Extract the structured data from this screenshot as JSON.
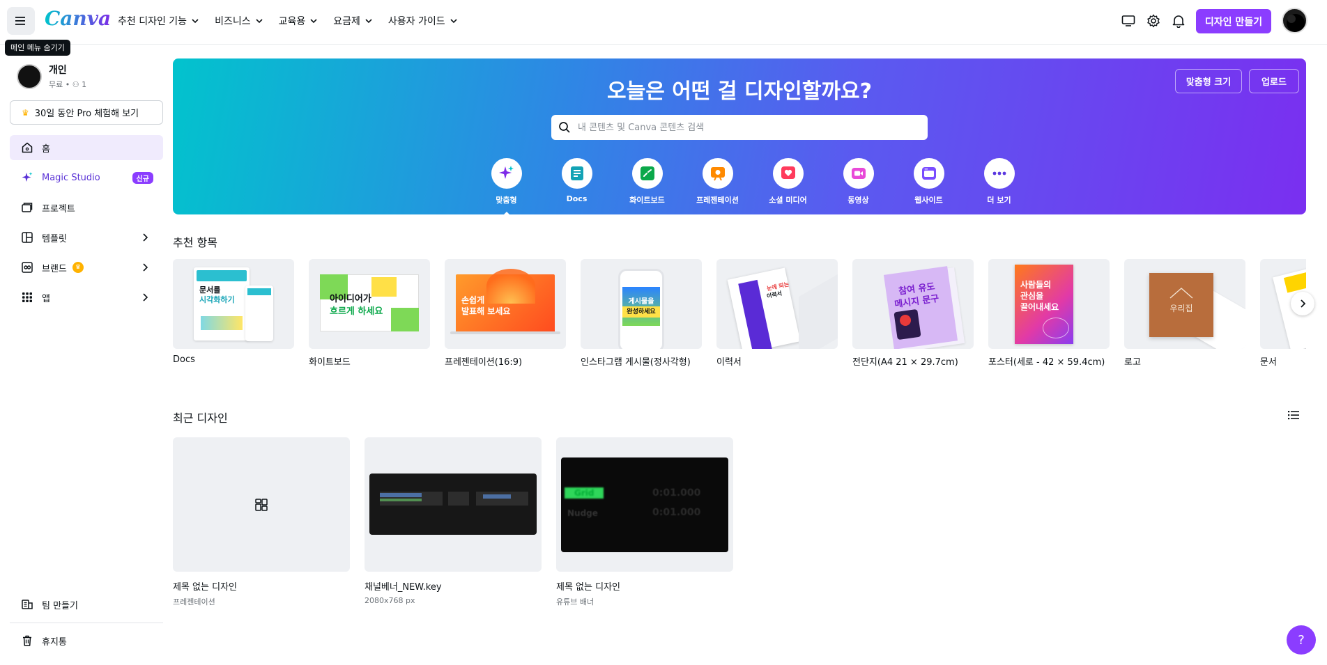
{
  "topbar": {
    "menu_tooltip": "메인 메뉴 숨기기",
    "logo": "Canva",
    "nav": [
      "추천 디자인 기능",
      "비즈니스",
      "교육용",
      "요금제",
      "사용자 가이드"
    ],
    "create_label": "디자인 만들기"
  },
  "sidebar": {
    "team_name": "개인",
    "team_meta": "무료 • ⚇ 1",
    "pro_label": "30일 동안 Pro 체험해 보기",
    "items": [
      {
        "label": "홈"
      },
      {
        "label": "Magic Studio",
        "badge": "신규"
      },
      {
        "label": "프로젝트"
      },
      {
        "label": "템플릿"
      },
      {
        "label": "브랜드"
      },
      {
        "label": "앱"
      }
    ],
    "bottom": [
      {
        "label": "팀 만들기"
      },
      {
        "label": "휴지통"
      }
    ]
  },
  "hero": {
    "title": "오늘은 어떤 걸 디자인할까요?",
    "custom_size": "맞춤형 크기",
    "upload": "업로드",
    "search_placeholder": "내 콘텐츠 및 Canva 콘텐츠 검색",
    "categories": [
      {
        "label": "맞춤형",
        "icon": "sparkle-icon",
        "color": "#7d2ae8"
      },
      {
        "label": "Docs",
        "icon": "docs-icon",
        "color": "#13a3b5"
      },
      {
        "label": "화이트보드",
        "icon": "whiteboard-icon",
        "color": "#0ba84a"
      },
      {
        "label": "프레젠테이션",
        "icon": "presentation-icon",
        "color": "#ff8a00"
      },
      {
        "label": "소셜 미디어",
        "icon": "heart-icon",
        "color": "#ff3b5c"
      },
      {
        "label": "동영상",
        "icon": "video-icon",
        "color": "#e84ad8"
      },
      {
        "label": "웹사이트",
        "icon": "website-icon",
        "color": "#7a4dff"
      },
      {
        "label": "더 보기",
        "icon": "more-icon",
        "color": "#5b38e0"
      }
    ]
  },
  "recommended": {
    "title": "추천 항목",
    "items": [
      {
        "label": "Docs"
      },
      {
        "label": "화이트보드"
      },
      {
        "label": "프레젠테이션(16:9)"
      },
      {
        "label": "인스타그램 게시물(정사각형)"
      },
      {
        "label": "이력서"
      },
      {
        "label": "전단지(A4 21 × 29.7cm)"
      },
      {
        "label": "포스터(세로 - 42 × 59.4cm)"
      },
      {
        "label": "로고"
      },
      {
        "label": "문서"
      }
    ],
    "thumb_text": {
      "docs_a": "문서를",
      "docs_b": "시각화하기",
      "whiteboard_a": "아이디어가",
      "whiteboard_b": "흐르게 하세요",
      "pres_a": "손쉽게",
      "pres_b": "발표해 보세요",
      "insta_a": "게시물을",
      "insta_b": "완성하세요",
      "resume_a": "눈에 띄는",
      "resume_b": "이력서",
      "flyer_a": "참여 유도",
      "flyer_b": "메시지 문구",
      "poster_a": "사람들의",
      "poster_b": "관심을",
      "poster_c": "끌어내세요",
      "logo": "우리집"
    }
  },
  "recent": {
    "title": "최근 디자인",
    "items": [
      {
        "name": "제목 없는 디자인",
        "sub": "프레젠테이션"
      },
      {
        "name": "채널베너_NEW.key",
        "sub": "2080x768 px"
      },
      {
        "name": "제목 없는 디자인",
        "sub": "유튜브 배너"
      }
    ],
    "thumb3_a": "Grid",
    "thumb3_b": "Nudge",
    "thumb3_val": "0:01.000"
  },
  "help_label": "?"
}
